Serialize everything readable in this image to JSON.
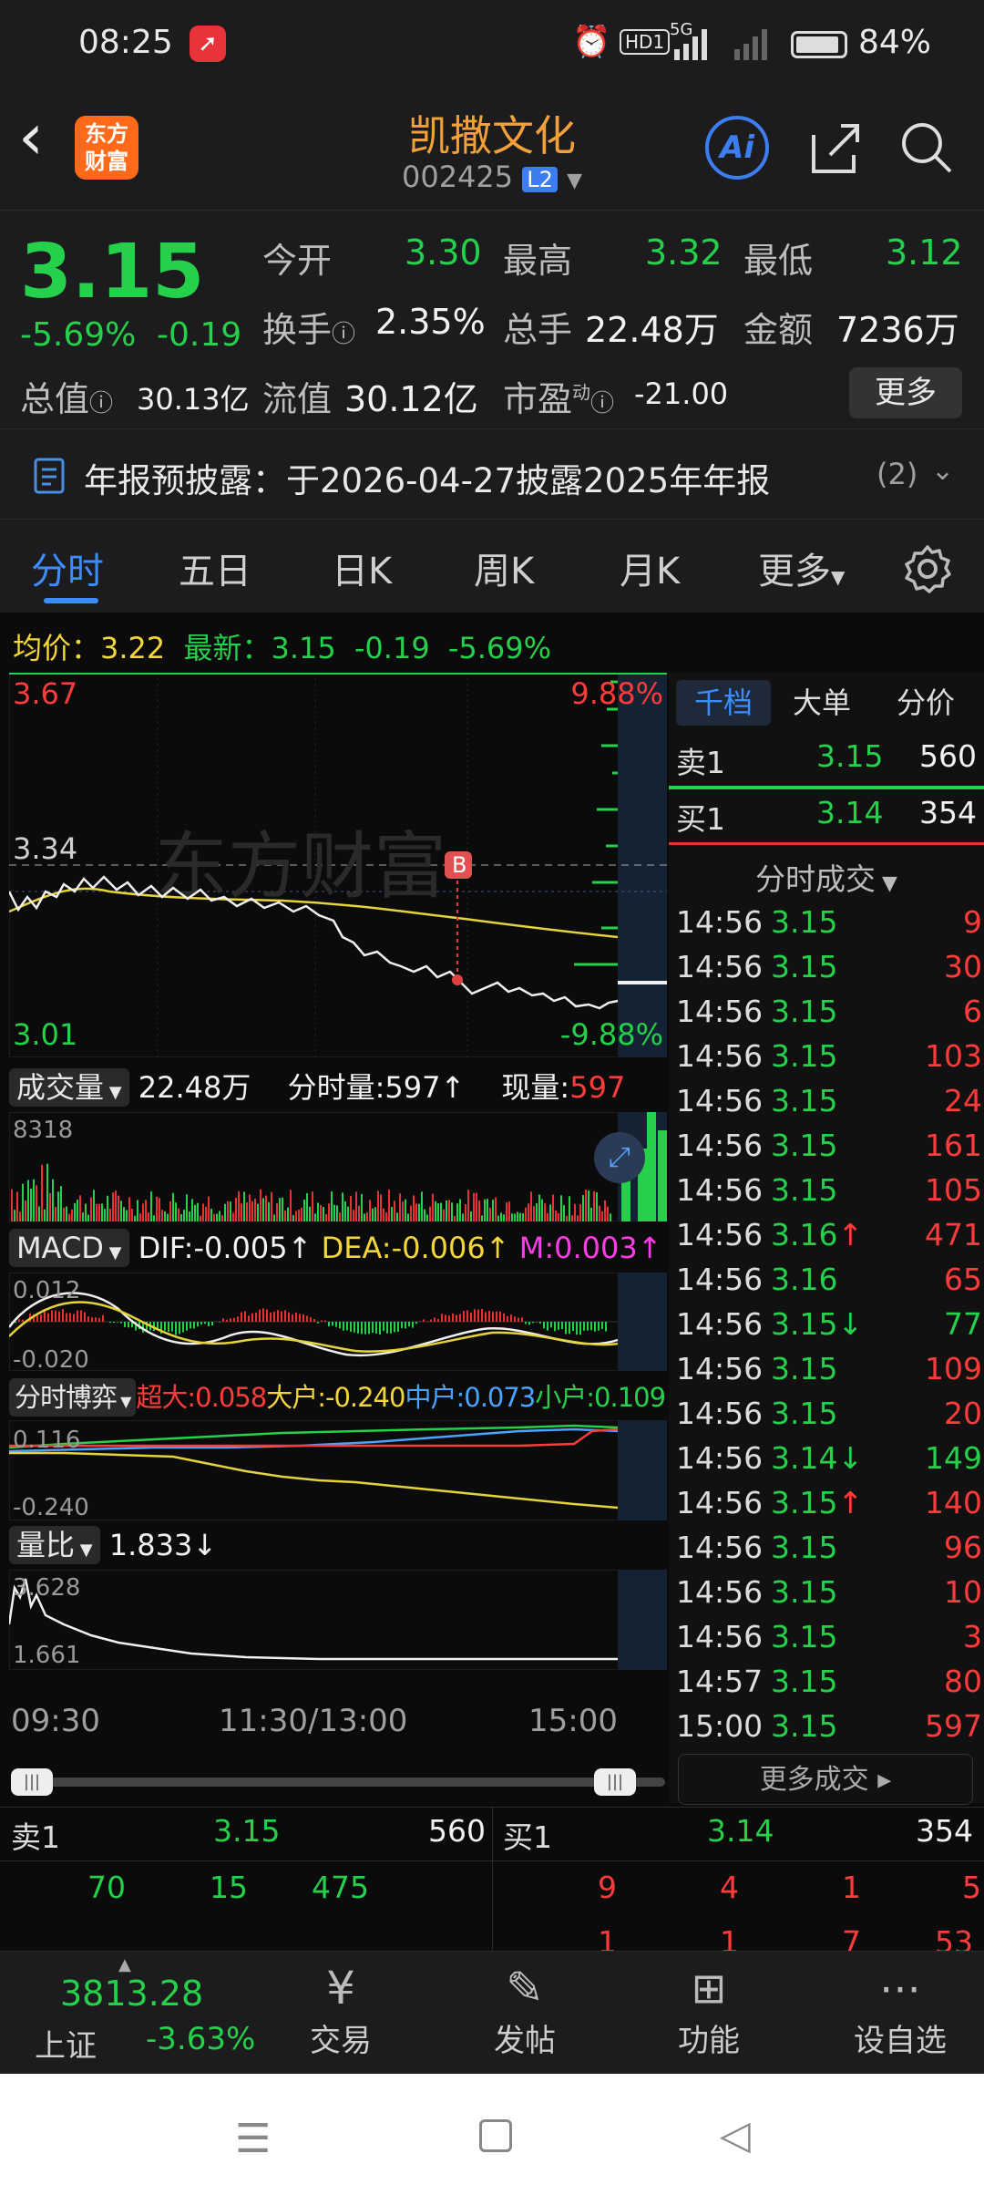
{
  "status": {
    "time": "08:25",
    "battery": "84%",
    "network": "5G",
    "hd": "HD1"
  },
  "header": {
    "logo_line1": "东方",
    "logo_line2": "财富",
    "name": "凯撒文化",
    "code": "002425",
    "level_badge": "L2",
    "ai_label": "Ai"
  },
  "quote": {
    "price": "3.15",
    "change_pct": "-5.69%",
    "change": "-0.19",
    "open_label": "今开",
    "open": "3.30",
    "high_label": "最高",
    "high": "3.32",
    "low_label": "最低",
    "low": "3.12",
    "turnover_label": "换手",
    "turnover": "2.35%",
    "volume_label": "总手",
    "volume": "22.48万",
    "amount_label": "金额",
    "amount": "7236万",
    "mktcap_label": "总值",
    "mktcap": "30.13亿",
    "float_label": "流值",
    "float": "30.12亿",
    "pe_label": "市盈",
    "pe_sup": "动",
    "pe": "-21.00",
    "more_button": "更多"
  },
  "notice": {
    "text": "年报预披露：于2026-04-27披露2025年年报",
    "count": "(2)"
  },
  "tabs": [
    "分时",
    "五日",
    "日K",
    "周K",
    "月K",
    "更多"
  ],
  "legend": {
    "avg_label": "均价：",
    "avg": "3.22",
    "latest_label": "最新：",
    "latest": "3.15",
    "change": "-0.19",
    "pct": "-5.69%"
  },
  "price_chart": {
    "top": "3.67",
    "top_pct": "9.88%",
    "ref": "3.34",
    "bottom": "3.01",
    "bottom_pct": "-9.88%",
    "marker": "B",
    "watermark": "东方财富"
  },
  "volume_panel": {
    "selector": "成交量",
    "total": "22.48万",
    "min_vol_label": "分时量:597",
    "now_label": "现量:",
    "now": "597",
    "max": "8318"
  },
  "macd_panel": {
    "selector": "MACD",
    "dif": "DIF:-0.005",
    "dea": "DEA:-0.006",
    "m": "M:0.003",
    "top": "0.012",
    "bottom": "-0.020"
  },
  "game_panel": {
    "selector": "分时博弈",
    "super": "超大:0.058",
    "big": "大户:-0.240",
    "mid": "中户:0.073",
    "small": "小户:0.109",
    "top": "0.116",
    "bottom": "-0.240"
  },
  "ratio_panel": {
    "selector": "量比",
    "value": "1.833",
    "top": "3.628",
    "bottom": "1.661"
  },
  "time_axis": [
    "09:30",
    "11:30/13:00",
    "15:00"
  ],
  "side_tabs": [
    "千档",
    "大单",
    "分价"
  ],
  "side_book": {
    "sell_label": "卖1",
    "sell_price": "3.15",
    "sell_vol": "560",
    "buy_label": "买1",
    "buy_price": "3.14",
    "buy_vol": "354"
  },
  "ticks_title": "分时成交",
  "ticks": [
    {
      "t": "14:56",
      "p": "3.15",
      "a": "",
      "v": "9",
      "vc": "red"
    },
    {
      "t": "14:56",
      "p": "3.15",
      "a": "",
      "v": "30",
      "vc": "red"
    },
    {
      "t": "14:56",
      "p": "3.15",
      "a": "",
      "v": "6",
      "vc": "red"
    },
    {
      "t": "14:56",
      "p": "3.15",
      "a": "",
      "v": "103",
      "vc": "red"
    },
    {
      "t": "14:56",
      "p": "3.15",
      "a": "",
      "v": "24",
      "vc": "red"
    },
    {
      "t": "14:56",
      "p": "3.15",
      "a": "",
      "v": "161",
      "vc": "red"
    },
    {
      "t": "14:56",
      "p": "3.15",
      "a": "",
      "v": "105",
      "vc": "red"
    },
    {
      "t": "14:56",
      "p": "3.16",
      "a": "↑",
      "v": "471",
      "vc": "red"
    },
    {
      "t": "14:56",
      "p": "3.16",
      "a": "",
      "v": "65",
      "vc": "red"
    },
    {
      "t": "14:56",
      "p": "3.15",
      "a": "↓",
      "v": "77",
      "vc": "green"
    },
    {
      "t": "14:56",
      "p": "3.15",
      "a": "",
      "v": "109",
      "vc": "red"
    },
    {
      "t": "14:56",
      "p": "3.15",
      "a": "",
      "v": "20",
      "vc": "red"
    },
    {
      "t": "14:56",
      "p": "3.14",
      "a": "↓",
      "v": "149",
      "vc": "green"
    },
    {
      "t": "14:56",
      "p": "3.15",
      "a": "↑",
      "v": "140",
      "vc": "red"
    },
    {
      "t": "14:56",
      "p": "3.15",
      "a": "",
      "v": "96",
      "vc": "red"
    },
    {
      "t": "14:56",
      "p": "3.15",
      "a": "",
      "v": "10",
      "vc": "red"
    },
    {
      "t": "14:56",
      "p": "3.15",
      "a": "",
      "v": "3",
      "vc": "red"
    },
    {
      "t": "14:57",
      "p": "3.15",
      "a": "",
      "v": "80",
      "vc": "red"
    },
    {
      "t": "15:00",
      "p": "3.15",
      "a": "",
      "v": "597",
      "vc": "red"
    }
  ],
  "more_ticks": "更多成交",
  "book_bottom": {
    "sell_label": "卖1",
    "sell_price": "3.15",
    "sell_vol": "560",
    "buy_label": "买1",
    "buy_price": "3.14",
    "buy_vol": "354",
    "sell_queue": [
      "70",
      "15",
      "475"
    ],
    "buy_queue": [
      "9",
      "4",
      "1",
      "5"
    ],
    "buy_queue2": [
      "1",
      "1",
      "7",
      "53"
    ]
  },
  "bottom_nav": {
    "index_value": "3813.28",
    "index_name": "上证",
    "index_pct": "-3.63%",
    "trade": "交易",
    "post": "发帖",
    "functions": "功能",
    "watchlist": "设自选"
  }
}
